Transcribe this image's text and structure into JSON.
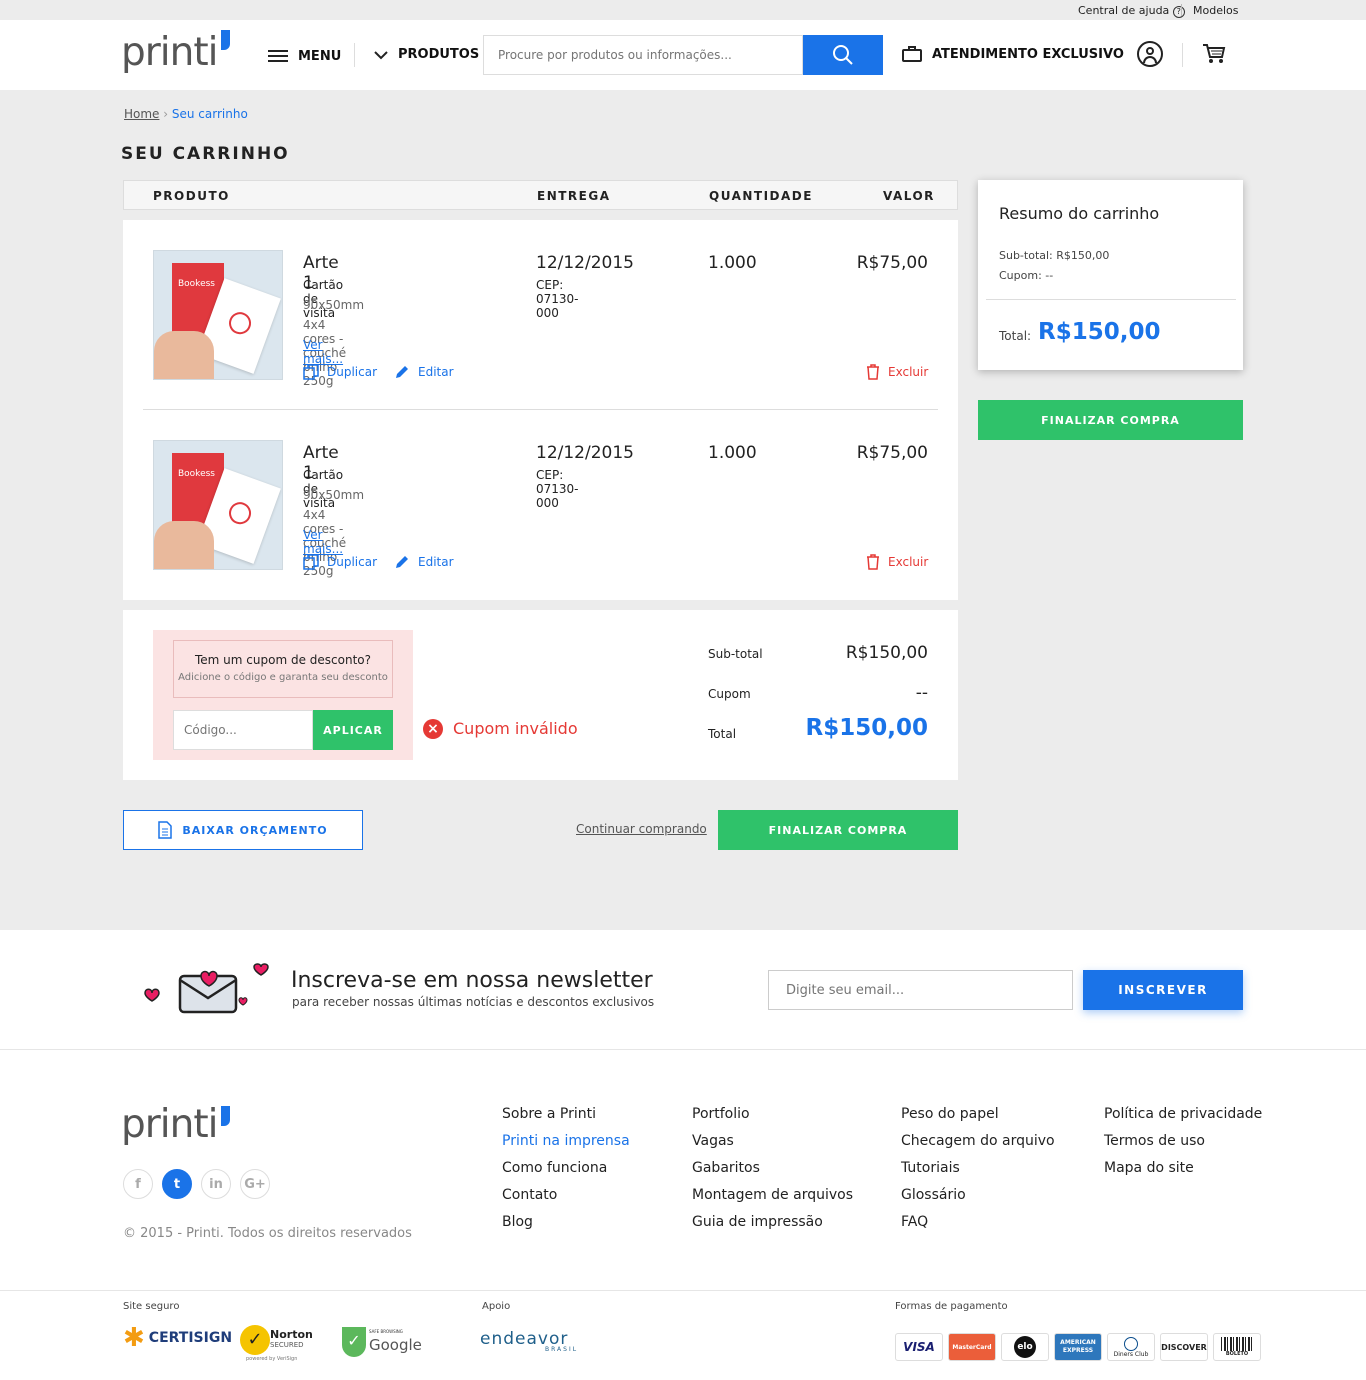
{
  "topbar": {
    "help": "Central de ajuda",
    "models": "Modelos"
  },
  "header": {
    "logo": "printi",
    "menu": "MENU",
    "products": "PRODUTOS",
    "search_placeholder": "Procure por produtos ou informações...",
    "support": "ATENDIMENTO EXCLUSIVO"
  },
  "breadcrumb": {
    "home": "Home",
    "current": "Seu carrinho"
  },
  "page_title": "SEU CARRINHO",
  "table_headers": {
    "product": "PRODUTO",
    "delivery": "ENTREGA",
    "quantity": "QUANTIDADE",
    "value": "VALOR"
  },
  "items": [
    {
      "thumb_brand": "Bookess",
      "name": "Arte 1",
      "type": "Cartão de visita",
      "size": "90x50mm",
      "spec": "4x4 cores - couché brilho 250g",
      "more": "Ver mais...",
      "date": "12/12/2015",
      "cep": "CEP: 07130-000",
      "qty": "1.000",
      "price": "R$75,00",
      "duplicate": "Duplicar",
      "edit": "Editar",
      "remove": "Excluir"
    },
    {
      "thumb_brand": "Bookess",
      "name": "Arte 1",
      "type": "Cartão de visita",
      "size": "90x50mm",
      "spec": "4x4 cores - couché brilho 250g",
      "more": "Ver mais...",
      "date": "12/12/2015",
      "cep": "CEP: 07130-000",
      "qty": "1.000",
      "price": "R$75,00",
      "duplicate": "Duplicar",
      "edit": "Editar",
      "remove": "Excluir"
    }
  ],
  "coupon": {
    "title": "Tem um cupom de desconto?",
    "subtitle": "Adicione o código e garanta seu desconto",
    "placeholder": "Código...",
    "apply": "APLICAR",
    "error": "Cupom inválido"
  },
  "totals": {
    "subtotal_label": "Sub-total",
    "subtotal": "R$150,00",
    "coupon_label": "Cupom",
    "coupon": "--",
    "total_label": "Total",
    "total": "R$150,00"
  },
  "actions": {
    "download": "BAIXAR ORÇAMENTO",
    "continue": "Continuar comprando",
    "checkout": "FINALIZAR COMPRA"
  },
  "summary": {
    "title": "Resumo do carrinho",
    "subtotal": "Sub-total: R$150,00",
    "coupon": "Cupom: --",
    "total_label": "Total:",
    "total": "R$150,00",
    "checkout": "FINALIZAR COMPRA"
  },
  "newsletter": {
    "title": "Inscreva-se em nossa newsletter",
    "subtitle": "para receber nossas últimas notícias e descontos exclusivos",
    "placeholder": "Digite seu email...",
    "button": "INSCREVER"
  },
  "footer": {
    "logo": "printi",
    "copyright": "© 2015 - Printi. Todos os direitos reservados",
    "social": [
      "f",
      "t",
      "in",
      "G+"
    ],
    "col1": [
      "Sobre a Printi",
      "Printi na imprensa",
      "Como funciona",
      "Contato",
      "Blog"
    ],
    "col2": [
      "Portfolio",
      "Vagas",
      "Gabaritos",
      "Montagem de arquivos",
      "Guia de impressão"
    ],
    "col3": [
      "Peso do papel",
      "Checagem do arquivo",
      "Tutoriais",
      "Glossário",
      "FAQ"
    ],
    "col4": [
      "Política de privacidade",
      "Termos de uso",
      "Mapa do site"
    ],
    "secure_label": "Site seguro",
    "support_label": "Apoio",
    "payment_label": "Formas de pagamento",
    "seals": [
      "CERTISIGN",
      "Norton",
      "SECURED",
      "powered by VeriSign",
      "SAFE BROWSING",
      "Google"
    ],
    "supporter": "endeavor",
    "supporter_sub": "BRASIL",
    "payments": [
      "VISA",
      "MasterCard",
      "elo",
      "AMERICAN EXPRESS",
      "Diners Club",
      "DISCOVER",
      "BOLETO"
    ]
  },
  "colors": {
    "blue": "#1a73e8",
    "green": "#2fc26a",
    "red": "#e53935",
    "bg": "#ececec"
  }
}
